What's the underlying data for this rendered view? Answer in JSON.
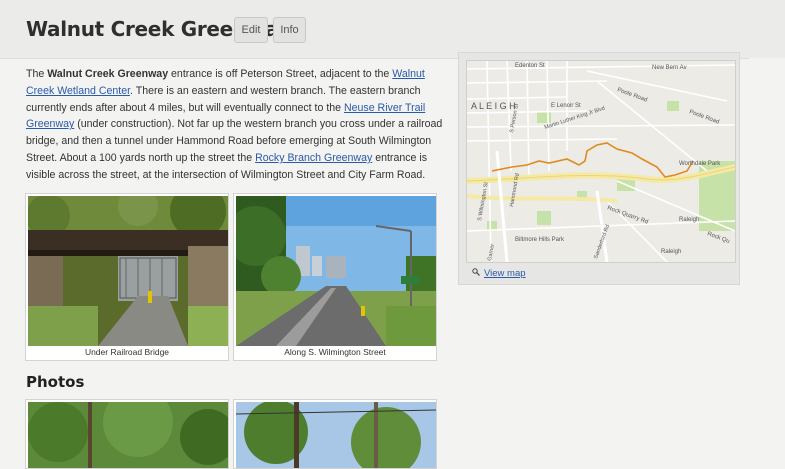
{
  "header": {
    "title": "Walnut Creek Greenway",
    "edit_label": "Edit",
    "info_label": "Info"
  },
  "description": {
    "p1_prefix": "The ",
    "p1_bold": "Walnut Creek Greenway",
    "p1_a": " entrance is off Peterson Street, adjacent to the ",
    "link_wetland": "Walnut Creek Wetland Center",
    "p1_b": ".  There is an eastern and western branch.  The eastern branch currently ends after about 4 miles, but will eventually connect to the ",
    "link_neuse": "Neuse River Trail Greenway",
    "p1_c": " (under construction).  Not far up the western branch you cross under a railroad bridge, and then a tunnel under Hammond Road before emerging at South Wilmington Street. About a 100 yards north up the street the ",
    "link_rocky": "Rocky Branch Greenway",
    "p1_d": " entrance is visible across the street, at the intersection of Wilmington Street and City Farm Road."
  },
  "photos": [
    {
      "caption": "Under Railroad Bridge"
    },
    {
      "caption": "Along  S. Wilmington Street"
    }
  ],
  "photos_section": {
    "title": "Photos"
  },
  "map": {
    "view_map_label": "View map",
    "labels": {
      "edenton": "Edenton St",
      "new_bern": "New Bern Av",
      "poole_rd_1": "Poole Road",
      "poole_rd_2": "Poole Road",
      "raleigh_big": "A L E I G H",
      "lenoir": "E Lenoir St",
      "mlk": "Martin Luther King Jr Blvd",
      "person": "S Person St",
      "worthdale": "Worthdale Park",
      "wilmington": "S Wilmington St",
      "hammond": "Hammond Rd",
      "rock_quarry": "Rock Quarry Rd",
      "raleigh_1": "Raleigh",
      "raleigh_2": "Raleigh",
      "rock_qu": "Rock Qu",
      "biltmore": "Biltmore Hills Park",
      "sanderford": "Sanderford Rd",
      "garner": "Garner"
    }
  },
  "colors": {
    "trail": "#e08a1e",
    "link": "#2a5aa8",
    "park": "#c6e2a8"
  }
}
